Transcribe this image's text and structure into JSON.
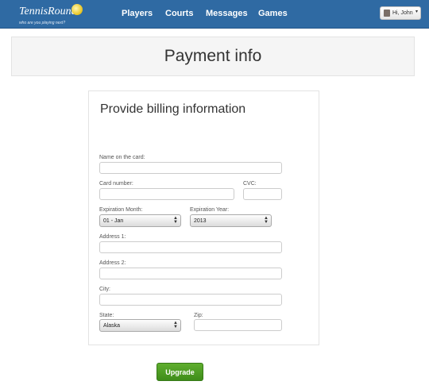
{
  "app": {
    "logo_text": "TennisRound",
    "logo_tagline": "who are you playing next?",
    "nav": [
      "Players",
      "Courts",
      "Messages",
      "Games"
    ],
    "user_label": "Hi, John"
  },
  "page": {
    "title": "Payment info"
  },
  "form": {
    "heading": "Provide billing information",
    "name_label": "Name on the card:",
    "name_value": "",
    "card_label": "Card number:",
    "card_value": "",
    "cvc_label": "CVC:",
    "cvc_value": "",
    "month_label": "Expiration Month:",
    "month_value": "01 - Jan",
    "year_label": "Expiration Year:",
    "year_value": "2013",
    "addr1_label": "Address 1:",
    "addr1_value": "",
    "addr2_label": "Address 2:",
    "addr2_value": "",
    "city_label": "City:",
    "city_value": "",
    "state_label": "State:",
    "state_value": "Alaska",
    "zip_label": "Zip:",
    "zip_value": "",
    "submit_label": "Upgrade"
  },
  "colors": {
    "nav_bg": "#2f6aa3",
    "primary_button": "#4b9b22"
  }
}
